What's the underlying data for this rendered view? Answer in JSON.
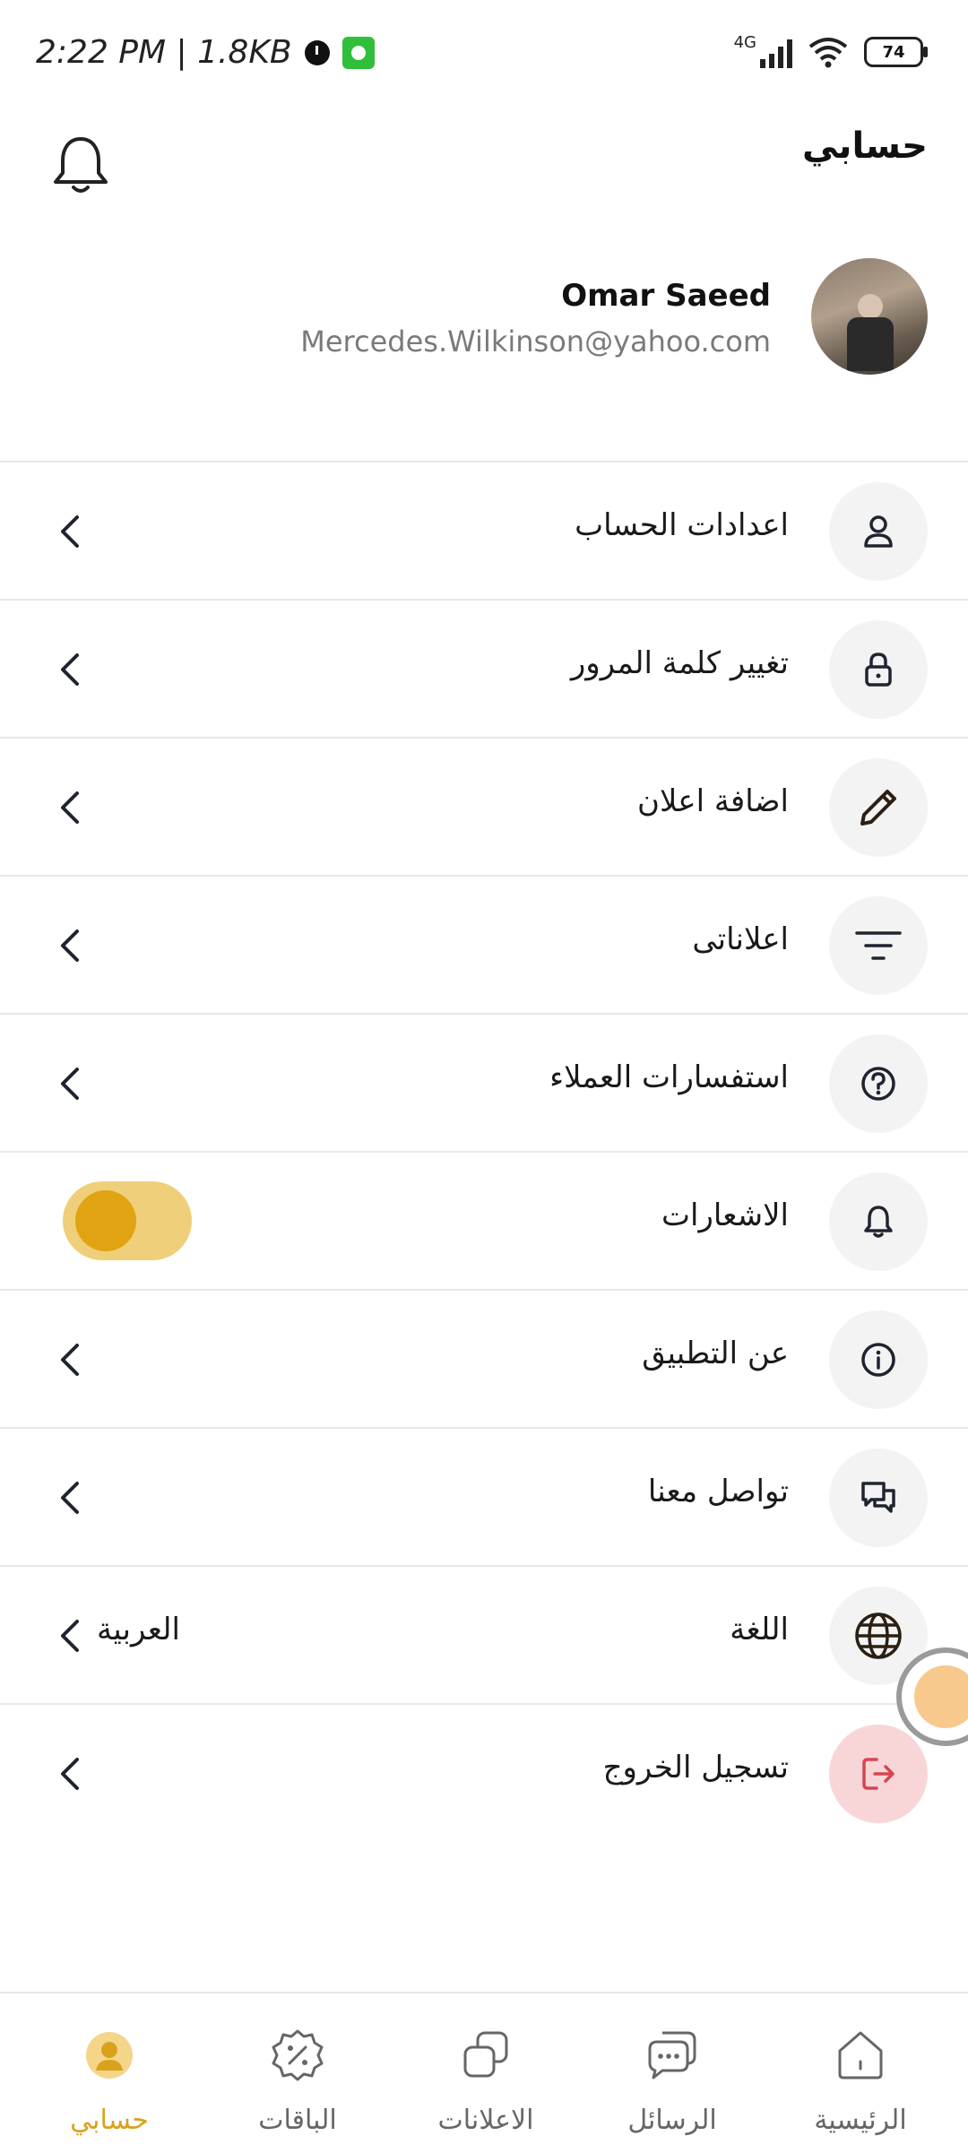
{
  "status_bar": {
    "time": "2:22 PM | 1.8KB",
    "network": "4G",
    "battery": "74"
  },
  "header": {
    "title": "حسابي"
  },
  "profile": {
    "name": "Omar Saeed",
    "email": "Mercedes.Wilkinson@yahoo.com"
  },
  "menu": {
    "items": [
      {
        "label": "اعدادات الحساب",
        "icon": "user-icon"
      },
      {
        "label": "تغيير كلمة المرور",
        "icon": "lock-icon"
      },
      {
        "label": "اضافة اعلان",
        "icon": "pencil-icon"
      },
      {
        "label": "اعلاناتى",
        "icon": "filter-icon"
      },
      {
        "label": "استفسارات العملاء",
        "icon": "help-icon"
      },
      {
        "label": "الاشعارات",
        "icon": "bell-icon",
        "toggle_on": true
      },
      {
        "label": "عن التطبيق",
        "icon": "info-icon"
      },
      {
        "label": "تواصل معنا",
        "icon": "chat-icon"
      },
      {
        "label": "اللغة",
        "icon": "globe-icon",
        "value": "العربية"
      },
      {
        "label": "تسجيل الخروج",
        "icon": "logout-icon"
      }
    ]
  },
  "bottom_nav": {
    "items": [
      {
        "label": "حسابي",
        "active": true
      },
      {
        "label": "الباقات"
      },
      {
        "label": "الاعلانات"
      },
      {
        "label": "الرسائل"
      },
      {
        "label": "الرئيسية"
      }
    ]
  },
  "colors": {
    "accent": "#e0a311",
    "toggle_track": "#efcf7a",
    "logout_bg": "#f8d6d8",
    "logout_icon": "#d64550"
  }
}
